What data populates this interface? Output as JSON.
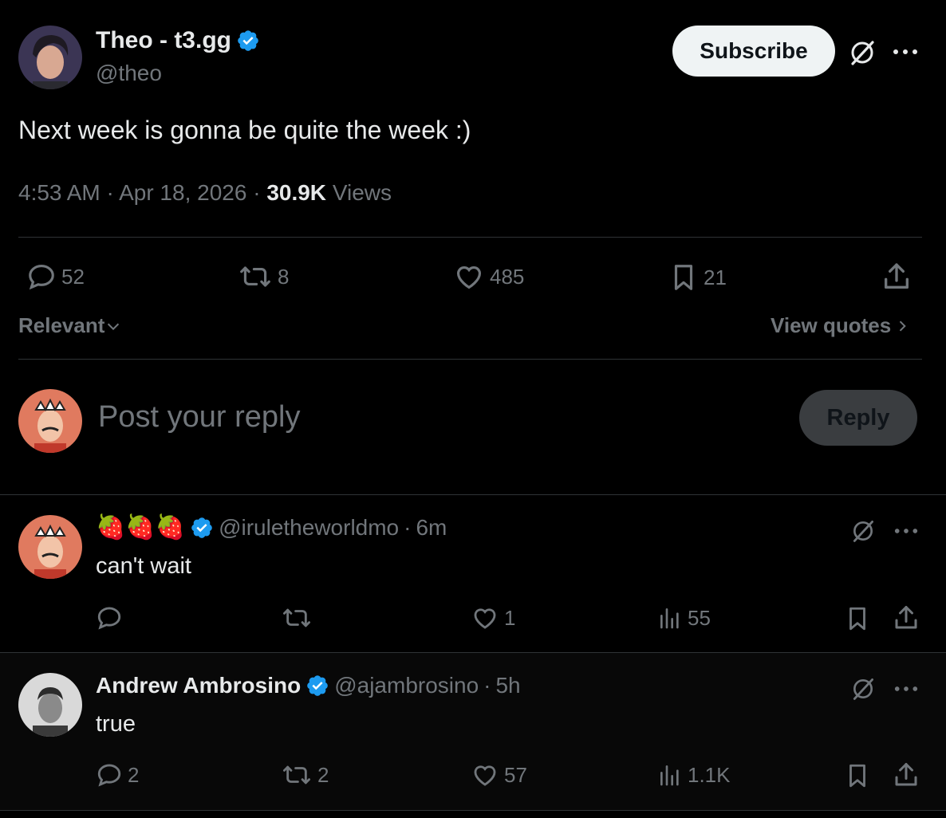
{
  "post": {
    "author_name": "Theo - t3.gg",
    "author_handle": "@theo",
    "subscribe_label": "Subscribe",
    "text": "Next week is gonna be quite the week :)",
    "time": "4:53 AM",
    "date": "Apr 18, 2026",
    "views_count": "30.9K",
    "views_label": "Views",
    "stats": {
      "replies": "52",
      "reposts": "8",
      "likes": "485",
      "bookmarks": "21"
    }
  },
  "sort": {
    "label": "Relevant",
    "view_quotes": "View quotes"
  },
  "composer": {
    "placeholder": "Post your reply",
    "reply_label": "Reply"
  },
  "replies": [
    {
      "name_emoji": "🍓🍓🍓",
      "handle": "@iruletheworldmo",
      "time": "6m",
      "text": "can't wait",
      "stats": {
        "replies": "",
        "reposts": "",
        "likes": "1",
        "views": "55"
      }
    },
    {
      "name": "Andrew Ambrosino",
      "handle": "@ajambrosino",
      "time": "5h",
      "text": "true",
      "stats": {
        "replies": "2",
        "reposts": "2",
        "likes": "57",
        "views": "1.1K"
      }
    }
  ],
  "icons": {
    "accent": "#1d9bf0",
    "muted": "#71767b"
  }
}
